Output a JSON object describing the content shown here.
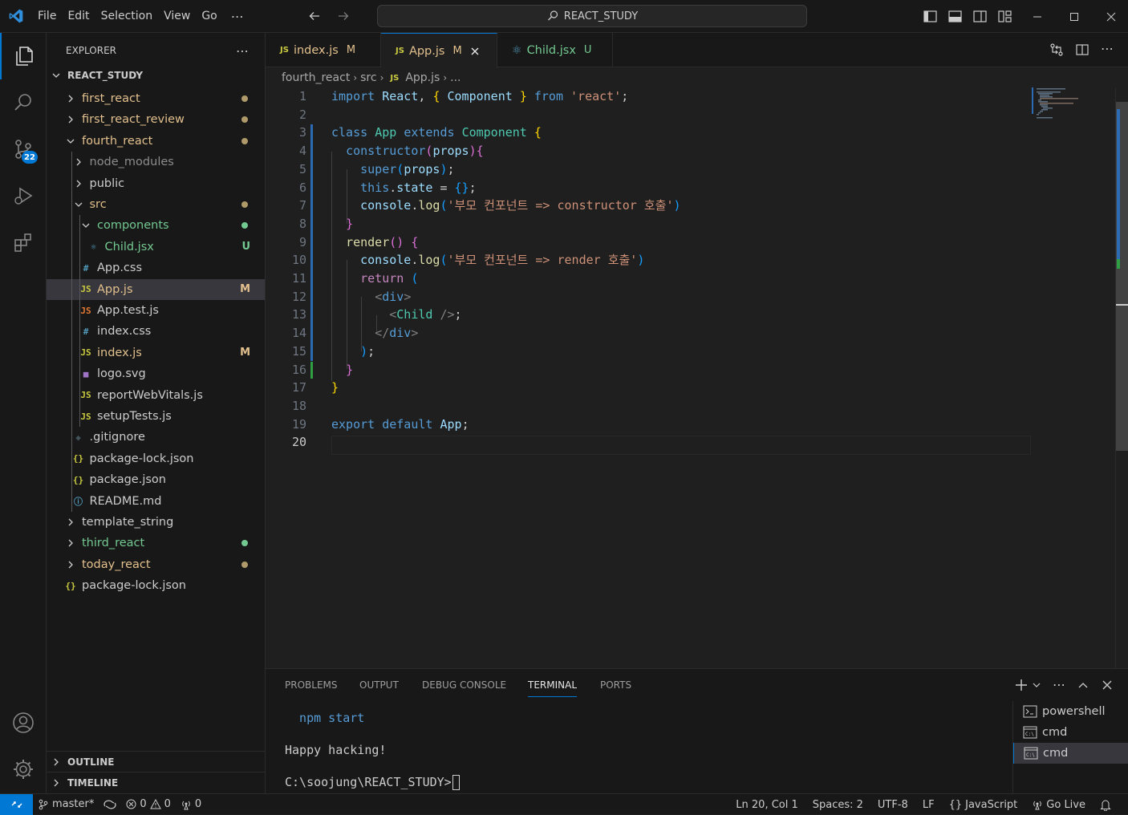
{
  "menu": [
    "File",
    "Edit",
    "Selection",
    "View",
    "Go"
  ],
  "title": "REACT_STUDY",
  "explorer": {
    "header": "EXPLORER",
    "root": "REACT_STUDY",
    "items": [
      {
        "label": "first_react",
        "type": "folder",
        "expanded": false,
        "depth": 0,
        "color": "#e2c08d",
        "dot": "#b09a6a"
      },
      {
        "label": "first_react_review",
        "type": "folder",
        "expanded": false,
        "depth": 0,
        "color": "#e2c08d",
        "dot": "#b09a6a"
      },
      {
        "label": "fourth_react",
        "type": "folder",
        "expanded": true,
        "depth": 0,
        "color": "#e2c08d",
        "dot": "#b09a6a"
      },
      {
        "label": "node_modules",
        "type": "folder",
        "expanded": false,
        "depth": 1,
        "color": "#8c8c8c"
      },
      {
        "label": "public",
        "type": "folder",
        "expanded": false,
        "depth": 1,
        "color": "#cccccc"
      },
      {
        "label": "src",
        "type": "folder",
        "expanded": true,
        "depth": 1,
        "color": "#e2c08d",
        "dot": "#b09a6a"
      },
      {
        "label": "components",
        "type": "folder",
        "expanded": true,
        "depth": 2,
        "color": "#73c991",
        "dot": "#73c991"
      },
      {
        "label": "Child.jsx",
        "type": "react",
        "depth": 3,
        "color": "#73c991",
        "decoration": "U"
      },
      {
        "label": "App.css",
        "type": "css",
        "depth": 2,
        "color": "#cccccc"
      },
      {
        "label": "App.js",
        "type": "js",
        "depth": 2,
        "color": "#e2c08d",
        "decoration": "M",
        "selected": true
      },
      {
        "label": "App.test.js",
        "type": "jstest",
        "depth": 2,
        "color": "#cccccc"
      },
      {
        "label": "index.css",
        "type": "css",
        "depth": 2,
        "color": "#cccccc"
      },
      {
        "label": "index.js",
        "type": "js",
        "depth": 2,
        "color": "#e2c08d",
        "decoration": "M"
      },
      {
        "label": "logo.svg",
        "type": "svg",
        "depth": 2,
        "color": "#cccccc"
      },
      {
        "label": "reportWebVitals.js",
        "type": "js",
        "depth": 2,
        "color": "#cccccc"
      },
      {
        "label": "setupTests.js",
        "type": "js",
        "depth": 2,
        "color": "#cccccc"
      },
      {
        "label": ".gitignore",
        "type": "git",
        "depth": 1,
        "color": "#cccccc"
      },
      {
        "label": "package-lock.json",
        "type": "json",
        "depth": 1,
        "color": "#cccccc"
      },
      {
        "label": "package.json",
        "type": "json",
        "depth": 1,
        "color": "#cccccc"
      },
      {
        "label": "README.md",
        "type": "info",
        "depth": 1,
        "color": "#cccccc"
      },
      {
        "label": "template_string",
        "type": "folder",
        "expanded": false,
        "depth": 0,
        "color": "#cccccc"
      },
      {
        "label": "third_react",
        "type": "folder",
        "expanded": false,
        "depth": 0,
        "color": "#73c991",
        "dot": "#73c991"
      },
      {
        "label": "today_react",
        "type": "folder",
        "expanded": false,
        "depth": 0,
        "color": "#e2c08d",
        "dot": "#b09a6a"
      },
      {
        "label": "package-lock.json",
        "type": "json",
        "depth": 0,
        "color": "#cccccc"
      }
    ],
    "outline": "OUTLINE",
    "timeline": "TIMELINE"
  },
  "source_control_badge": "22",
  "tabs": [
    {
      "label": "index.js",
      "decoration": "M",
      "icon": "js-icon",
      "color": "#e2c08d"
    },
    {
      "label": "App.js",
      "decoration": "M",
      "icon": "js-icon",
      "color": "#e2c08d",
      "active": true
    },
    {
      "label": "Child.jsx",
      "decoration": "U",
      "icon": "react-icon",
      "color": "#73c991"
    }
  ],
  "breadcrumb": [
    "fourth_react",
    "src",
    "App.js",
    "..."
  ],
  "code_lines": [
    [
      [
        "kw",
        "import"
      ],
      [
        "pl",
        " "
      ],
      [
        "var",
        "React"
      ],
      [
        "pl",
        ", "
      ],
      [
        "br1",
        "{"
      ],
      [
        "pl",
        " "
      ],
      [
        "var",
        "Component"
      ],
      [
        "pl",
        " "
      ],
      [
        "br1",
        "}"
      ],
      [
        "pl",
        " "
      ],
      [
        "kw",
        "from"
      ],
      [
        "pl",
        " "
      ],
      [
        "str",
        "'react'"
      ],
      [
        "pl",
        ";"
      ]
    ],
    [],
    [
      [
        "kw",
        "class"
      ],
      [
        "pl",
        " "
      ],
      [
        "cls",
        "App"
      ],
      [
        "pl",
        " "
      ],
      [
        "kw",
        "extends"
      ],
      [
        "pl",
        " "
      ],
      [
        "cls",
        "Component"
      ],
      [
        "pl",
        " "
      ],
      [
        "br1",
        "{"
      ]
    ],
    [
      [
        "pl",
        "  "
      ],
      [
        "kw",
        "constructor"
      ],
      [
        "br2",
        "("
      ],
      [
        "var",
        "props"
      ],
      [
        "br2",
        ")"
      ],
      [
        "br2",
        "{"
      ]
    ],
    [
      [
        "pl",
        "    "
      ],
      [
        "kw",
        "super"
      ],
      [
        "br3",
        "("
      ],
      [
        "var",
        "props"
      ],
      [
        "br3",
        ")"
      ],
      [
        "pl",
        ";"
      ]
    ],
    [
      [
        "pl",
        "    "
      ],
      [
        "kw",
        "this"
      ],
      [
        "pl",
        "."
      ],
      [
        "var",
        "state"
      ],
      [
        "pl",
        " "
      ],
      [
        "op",
        "="
      ],
      [
        "pl",
        " "
      ],
      [
        "br3",
        "{}"
      ],
      [
        "pl",
        ";"
      ]
    ],
    [
      [
        "pl",
        "    "
      ],
      [
        "var",
        "console"
      ],
      [
        "pl",
        "."
      ],
      [
        "fn",
        "log"
      ],
      [
        "br3",
        "("
      ],
      [
        "str",
        "'부모 컨포넌트 => constructor 호출'"
      ],
      [
        "br3",
        ")"
      ]
    ],
    [
      [
        "pl",
        "  "
      ],
      [
        "br2",
        "}"
      ]
    ],
    [
      [
        "pl",
        "  "
      ],
      [
        "fn",
        "render"
      ],
      [
        "br2",
        "()"
      ],
      [
        "pl",
        " "
      ],
      [
        "br2",
        "{"
      ]
    ],
    [
      [
        "pl",
        "    "
      ],
      [
        "var",
        "console"
      ],
      [
        "pl",
        "."
      ],
      [
        "fn",
        "log"
      ],
      [
        "br3",
        "("
      ],
      [
        "str",
        "'부모 컨포넌트 => render 호출'"
      ],
      [
        "br3",
        ")"
      ]
    ],
    [
      [
        "pl",
        "    "
      ],
      [
        "ctrl",
        "return"
      ],
      [
        "pl",
        " "
      ],
      [
        "br3",
        "("
      ]
    ],
    [
      [
        "pl",
        "      "
      ],
      [
        "tagb",
        "<"
      ],
      [
        "tag",
        "div"
      ],
      [
        "tagb",
        ">"
      ]
    ],
    [
      [
        "pl",
        "        "
      ],
      [
        "tagb",
        "<"
      ],
      [
        "cls",
        "Child"
      ],
      [
        "pl",
        " "
      ],
      [
        "tagb",
        "/>"
      ],
      [
        "pl",
        ";"
      ]
    ],
    [
      [
        "pl",
        "      "
      ],
      [
        "tagb",
        "</"
      ],
      [
        "tag",
        "div"
      ],
      [
        "tagb",
        ">"
      ]
    ],
    [
      [
        "pl",
        "    "
      ],
      [
        "br3",
        ")"
      ],
      [
        "pl",
        ";"
      ]
    ],
    [
      [
        "pl",
        "  "
      ],
      [
        "br2",
        "}"
      ]
    ],
    [
      [
        "br1",
        "}"
      ]
    ],
    [],
    [
      [
        "kw",
        "export"
      ],
      [
        "pl",
        " "
      ],
      [
        "kw",
        "default"
      ],
      [
        "pl",
        " "
      ],
      [
        "var",
        "App"
      ],
      [
        "pl",
        ";"
      ]
    ],
    []
  ],
  "current_line": 20,
  "panel": {
    "tabs": [
      "PROBLEMS",
      "OUTPUT",
      "DEBUG CONSOLE",
      "TERMINAL",
      "PORTS"
    ],
    "active_tab": "TERMINAL",
    "terminal_lines": [
      "  npm start",
      "Happy hacking!",
      "C:\\soojung\\REACT_STUDY>"
    ],
    "terminals": [
      {
        "label": "powershell",
        "icon": "powershell-icon"
      },
      {
        "label": "cmd",
        "icon": "cmd-icon"
      },
      {
        "label": "cmd",
        "icon": "cmd-icon",
        "selected": true
      }
    ]
  },
  "status": {
    "branch": "master*",
    "errors": "0",
    "warnings": "0",
    "ports": "0",
    "position": "Ln 20, Col 1",
    "spaces": "Spaces: 2",
    "encoding": "UTF-8",
    "eol": "LF",
    "language": "JavaScript",
    "golive": "Go Live"
  }
}
